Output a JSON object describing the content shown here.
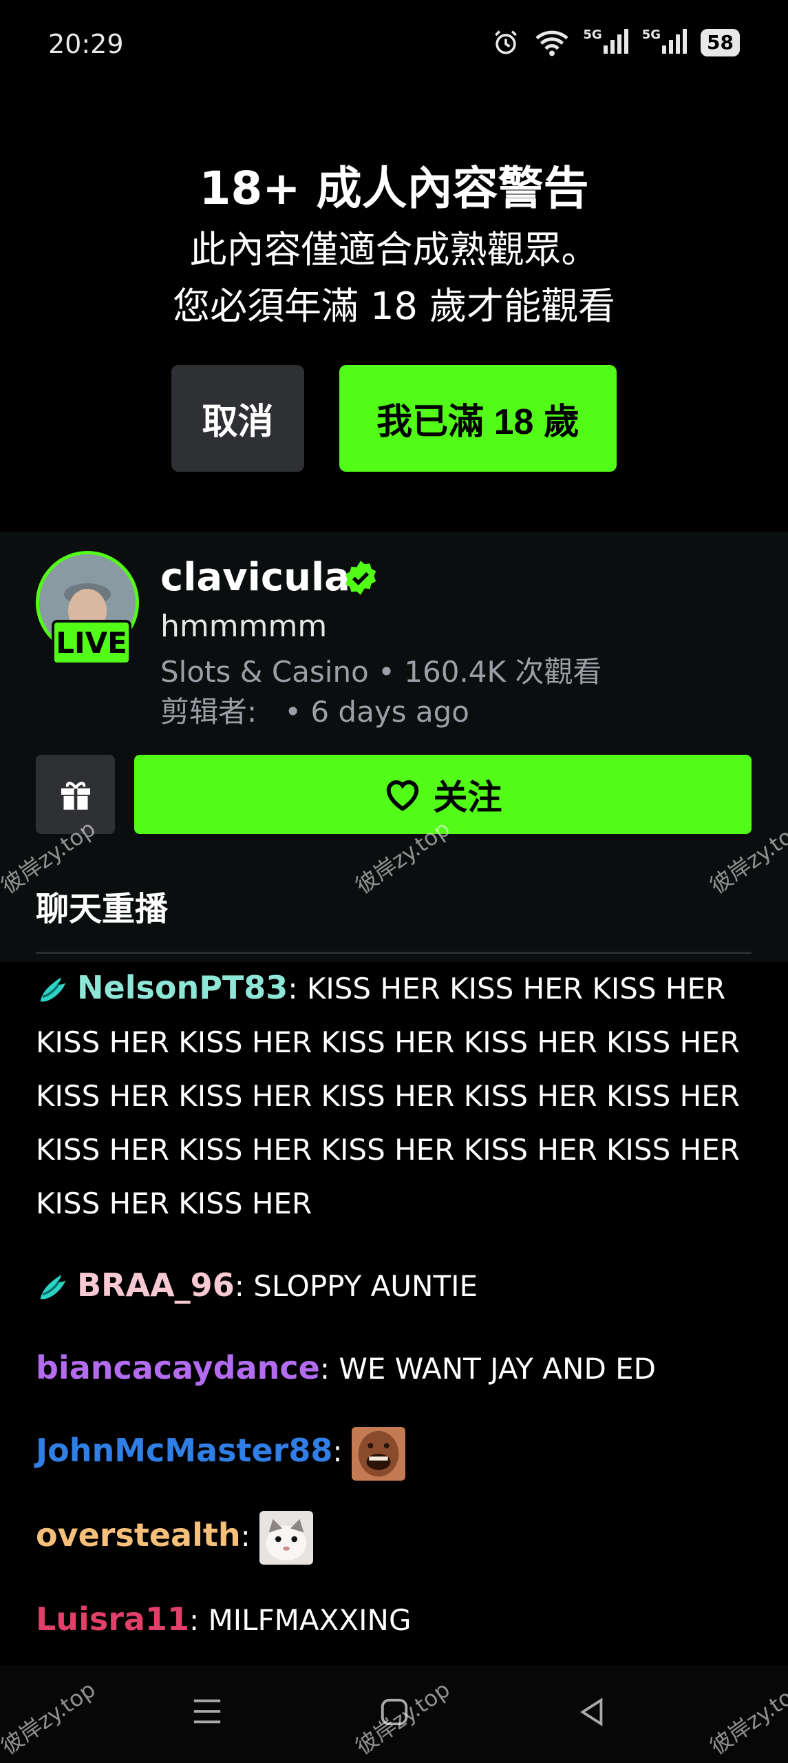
{
  "status_bar": {
    "time": "20:29",
    "battery": "58",
    "signal_label": "5G"
  },
  "warning": {
    "title": "18+ 成人內容警告",
    "line1": "此內容僅適合成熟觀眾。",
    "line2": "您必須年滿 18 歲才能觀看",
    "cancel_label": "取消",
    "confirm_label": "我已滿 18 歲"
  },
  "stream": {
    "live_badge": "LIVE",
    "streamer": "clavicular",
    "title": "hmmmmm",
    "category": "Slots & Casino",
    "views": "160.4K 次觀看",
    "clipper_label": "剪辑者:",
    "age": "6 days ago",
    "follow_label": "关注"
  },
  "chat": {
    "header": "聊天重播",
    "messages": [
      {
        "user": "NelsonPT83",
        "color": "#8ee6d6",
        "badge": true,
        "text": "KISS HER KISS HER KISS HER KISS HER KISS HER KISS HER KISS HER KISS HER KISS HER KISS HER KISS HER KISS HER KISS HER KISS HER KISS HER KISS HER KISS HER KISS HER KISS HER KISS HER"
      },
      {
        "user": "BRAA_96",
        "color": "#f7c9d3",
        "badge": true,
        "text": "SLOPPY AUNTIE"
      },
      {
        "user": "biancacaydance",
        "color": "#b36cf0",
        "badge": false,
        "text": "WE WANT JAY AND ED"
      },
      {
        "user": "JohnMcMaster88",
        "color": "#2f7fe6",
        "badge": false,
        "text": "",
        "emote": "laughing-face"
      },
      {
        "user": "overstealth",
        "color": "#f6c07a",
        "badge": false,
        "text": "",
        "emote": "cat-face"
      },
      {
        "user": "Luisra11",
        "color": "#e0406a",
        "badge": false,
        "text": "MILFMAXXING"
      }
    ]
  },
  "watermark": "彼岸zy.top",
  "colors": {
    "accent": "#53fc18",
    "panel": "#0b0e0f",
    "button_dark": "#2f3033"
  }
}
